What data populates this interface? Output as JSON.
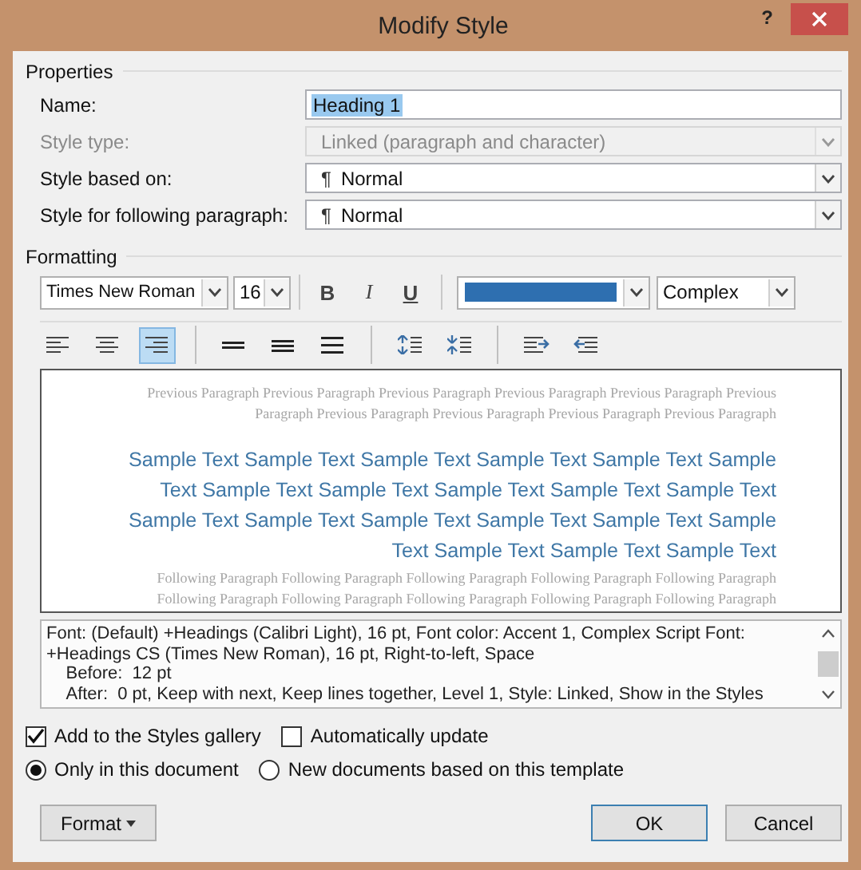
{
  "window": {
    "title": "Modify Style",
    "help": "?"
  },
  "properties": {
    "heading": "Properties",
    "fields": [
      {
        "label": "Name:",
        "kind": "text",
        "value": "Heading 1",
        "value_selected": true,
        "disabled": false
      },
      {
        "label": "Style type:",
        "kind": "dropdown",
        "value": "Linked (paragraph and character)",
        "value_selected": false,
        "disabled": true
      },
      {
        "label": "Style based on:",
        "kind": "dropdown",
        "symbol": "¶",
        "value": "Normal",
        "value_selected": false,
        "disabled": false
      },
      {
        "label": "Style for following paragraph:",
        "kind": "dropdown",
        "symbol": "¶",
        "value": "Normal",
        "value_selected": false,
        "disabled": false
      }
    ]
  },
  "formatting": {
    "heading": "Formatting",
    "font": "Times New Roman",
    "size": "16",
    "style_buttons": [
      {
        "label": "B",
        "kind": "bold",
        "selected": false
      },
      {
        "label": "I",
        "kind": "italic",
        "selected": false
      },
      {
        "label": "U",
        "kind": "underline",
        "selected": false
      }
    ],
    "color_swatch": {
      "color": "#2e6fb0"
    },
    "script": "Complex",
    "paragraph_tools": [
      [
        {
          "kind": "align-left",
          "selected": false
        },
        {
          "kind": "align-center",
          "selected": false
        },
        {
          "kind": "align-right",
          "selected": true
        }
      ],
      [
        {
          "kind": "single",
          "selected": false
        },
        {
          "kind": "one-half",
          "selected": false
        },
        {
          "kind": "double",
          "selected": false
        }
      ],
      [
        {
          "kind": "space-more",
          "selected": false
        },
        {
          "kind": "space-less",
          "selected": false
        }
      ],
      [
        {
          "kind": "indent-more",
          "selected": false
        },
        {
          "kind": "indent-less",
          "selected": false
        }
      ]
    ]
  },
  "preview": {
    "previous": "Previous Paragraph Previous Paragraph Previous Paragraph Previous Paragraph Previous Paragraph Previous Paragraph Previous Paragraph Previous Paragraph Previous Paragraph Previous Paragraph",
    "sample": "Sample Text Sample Text Sample Text Sample Text Sample Text Sample Text Sample Text Sample Text Sample Text Sample Text Sample Text Sample Text Sample Text Sample Text Sample Text Sample Text Sample Text Sample Text Sample Text Sample Text",
    "following": "Following Paragraph Following Paragraph Following Paragraph Following Paragraph Following Paragraph Following Paragraph Following Paragraph Following Paragraph Following Paragraph Following Paragraph"
  },
  "description": "Font: (Default) +Headings (Calibri Light), 16 pt, Font color: Accent 1, Complex Script Font: +Headings CS (Times New Roman), 16 pt, Right-to-left, Space\n    Before:  12 pt\n    After:  0 pt, Keep with next, Keep lines together, Level 1, Style: Linked, Show in the Styles",
  "checkboxes": [
    {
      "label": "Add to the Styles gallery",
      "checked": true
    },
    {
      "label": "Automatically update",
      "checked": false
    }
  ],
  "radios": [
    {
      "label": "Only in this document",
      "selected": true
    },
    {
      "label": "New documents based on this template",
      "selected": false
    }
  ],
  "buttons": [
    {
      "label": "Format",
      "kind": "menu",
      "default": false
    },
    {
      "label": "OK",
      "kind": "plain",
      "default": true
    },
    {
      "label": "Cancel",
      "kind": "plain",
      "default": false
    }
  ]
}
